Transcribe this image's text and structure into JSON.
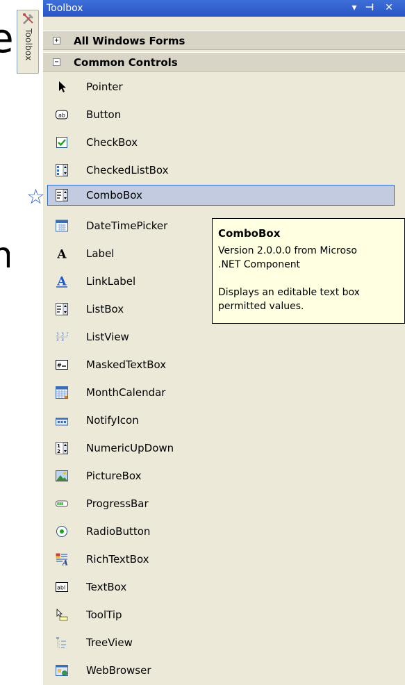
{
  "window": {
    "title": "Toolbox",
    "side_tab_label": "Toolbox",
    "buttons": {
      "pin": "▾",
      "autohide": "⊣",
      "close": "✕"
    }
  },
  "sections": [
    {
      "label": "All Windows Forms",
      "expander": "+",
      "expanded": false
    },
    {
      "label": "Common Controls",
      "expander": "−",
      "expanded": true
    }
  ],
  "items": [
    {
      "label": "Pointer",
      "icon": "pointer-icon"
    },
    {
      "label": "Button",
      "icon": "button-icon"
    },
    {
      "label": "CheckBox",
      "icon": "checkbox-icon"
    },
    {
      "label": "CheckedListBox",
      "icon": "checkedlistbox-icon"
    },
    {
      "label": "ComboBox",
      "icon": "combobox-icon",
      "selected": true
    },
    {
      "label": "DateTimePicker",
      "icon": "datetimepicker-icon"
    },
    {
      "label": "Label",
      "icon": "label-icon"
    },
    {
      "label": "LinkLabel",
      "icon": "linklabel-icon"
    },
    {
      "label": "ListBox",
      "icon": "listbox-icon"
    },
    {
      "label": "ListView",
      "icon": "listview-icon"
    },
    {
      "label": "MaskedTextBox",
      "icon": "maskedtextbox-icon"
    },
    {
      "label": "MonthCalendar",
      "icon": "monthcalendar-icon"
    },
    {
      "label": "NotifyIcon",
      "icon": "notifyicon-icon"
    },
    {
      "label": "NumericUpDown",
      "icon": "numericupdown-icon"
    },
    {
      "label": "PictureBox",
      "icon": "picturebox-icon"
    },
    {
      "label": "ProgressBar",
      "icon": "progressbar-icon"
    },
    {
      "label": "RadioButton",
      "icon": "radiobutton-icon"
    },
    {
      "label": "RichTextBox",
      "icon": "richtextbox-icon"
    },
    {
      "label": "TextBox",
      "icon": "textbox-icon"
    },
    {
      "label": "ToolTip",
      "icon": "tooltip-icon"
    },
    {
      "label": "TreeView",
      "icon": "treeview-icon"
    },
    {
      "label": "WebBrowser",
      "icon": "webbrowser-icon"
    }
  ],
  "tooltip": {
    "title": "ComboBox",
    "line1": "Version 2.0.0.0 from Microso",
    "line2": ".NET Component",
    "line3": "Displays an editable text box",
    "line4": "permitted values."
  },
  "colors": {
    "titlebar": "#2a55c4",
    "panel": "#ece9d8",
    "selection": "#c2cbe0",
    "selection_border": "#316ac5",
    "tooltip_bg": "#ffffe1",
    "marker_star": "#3a68d8"
  }
}
